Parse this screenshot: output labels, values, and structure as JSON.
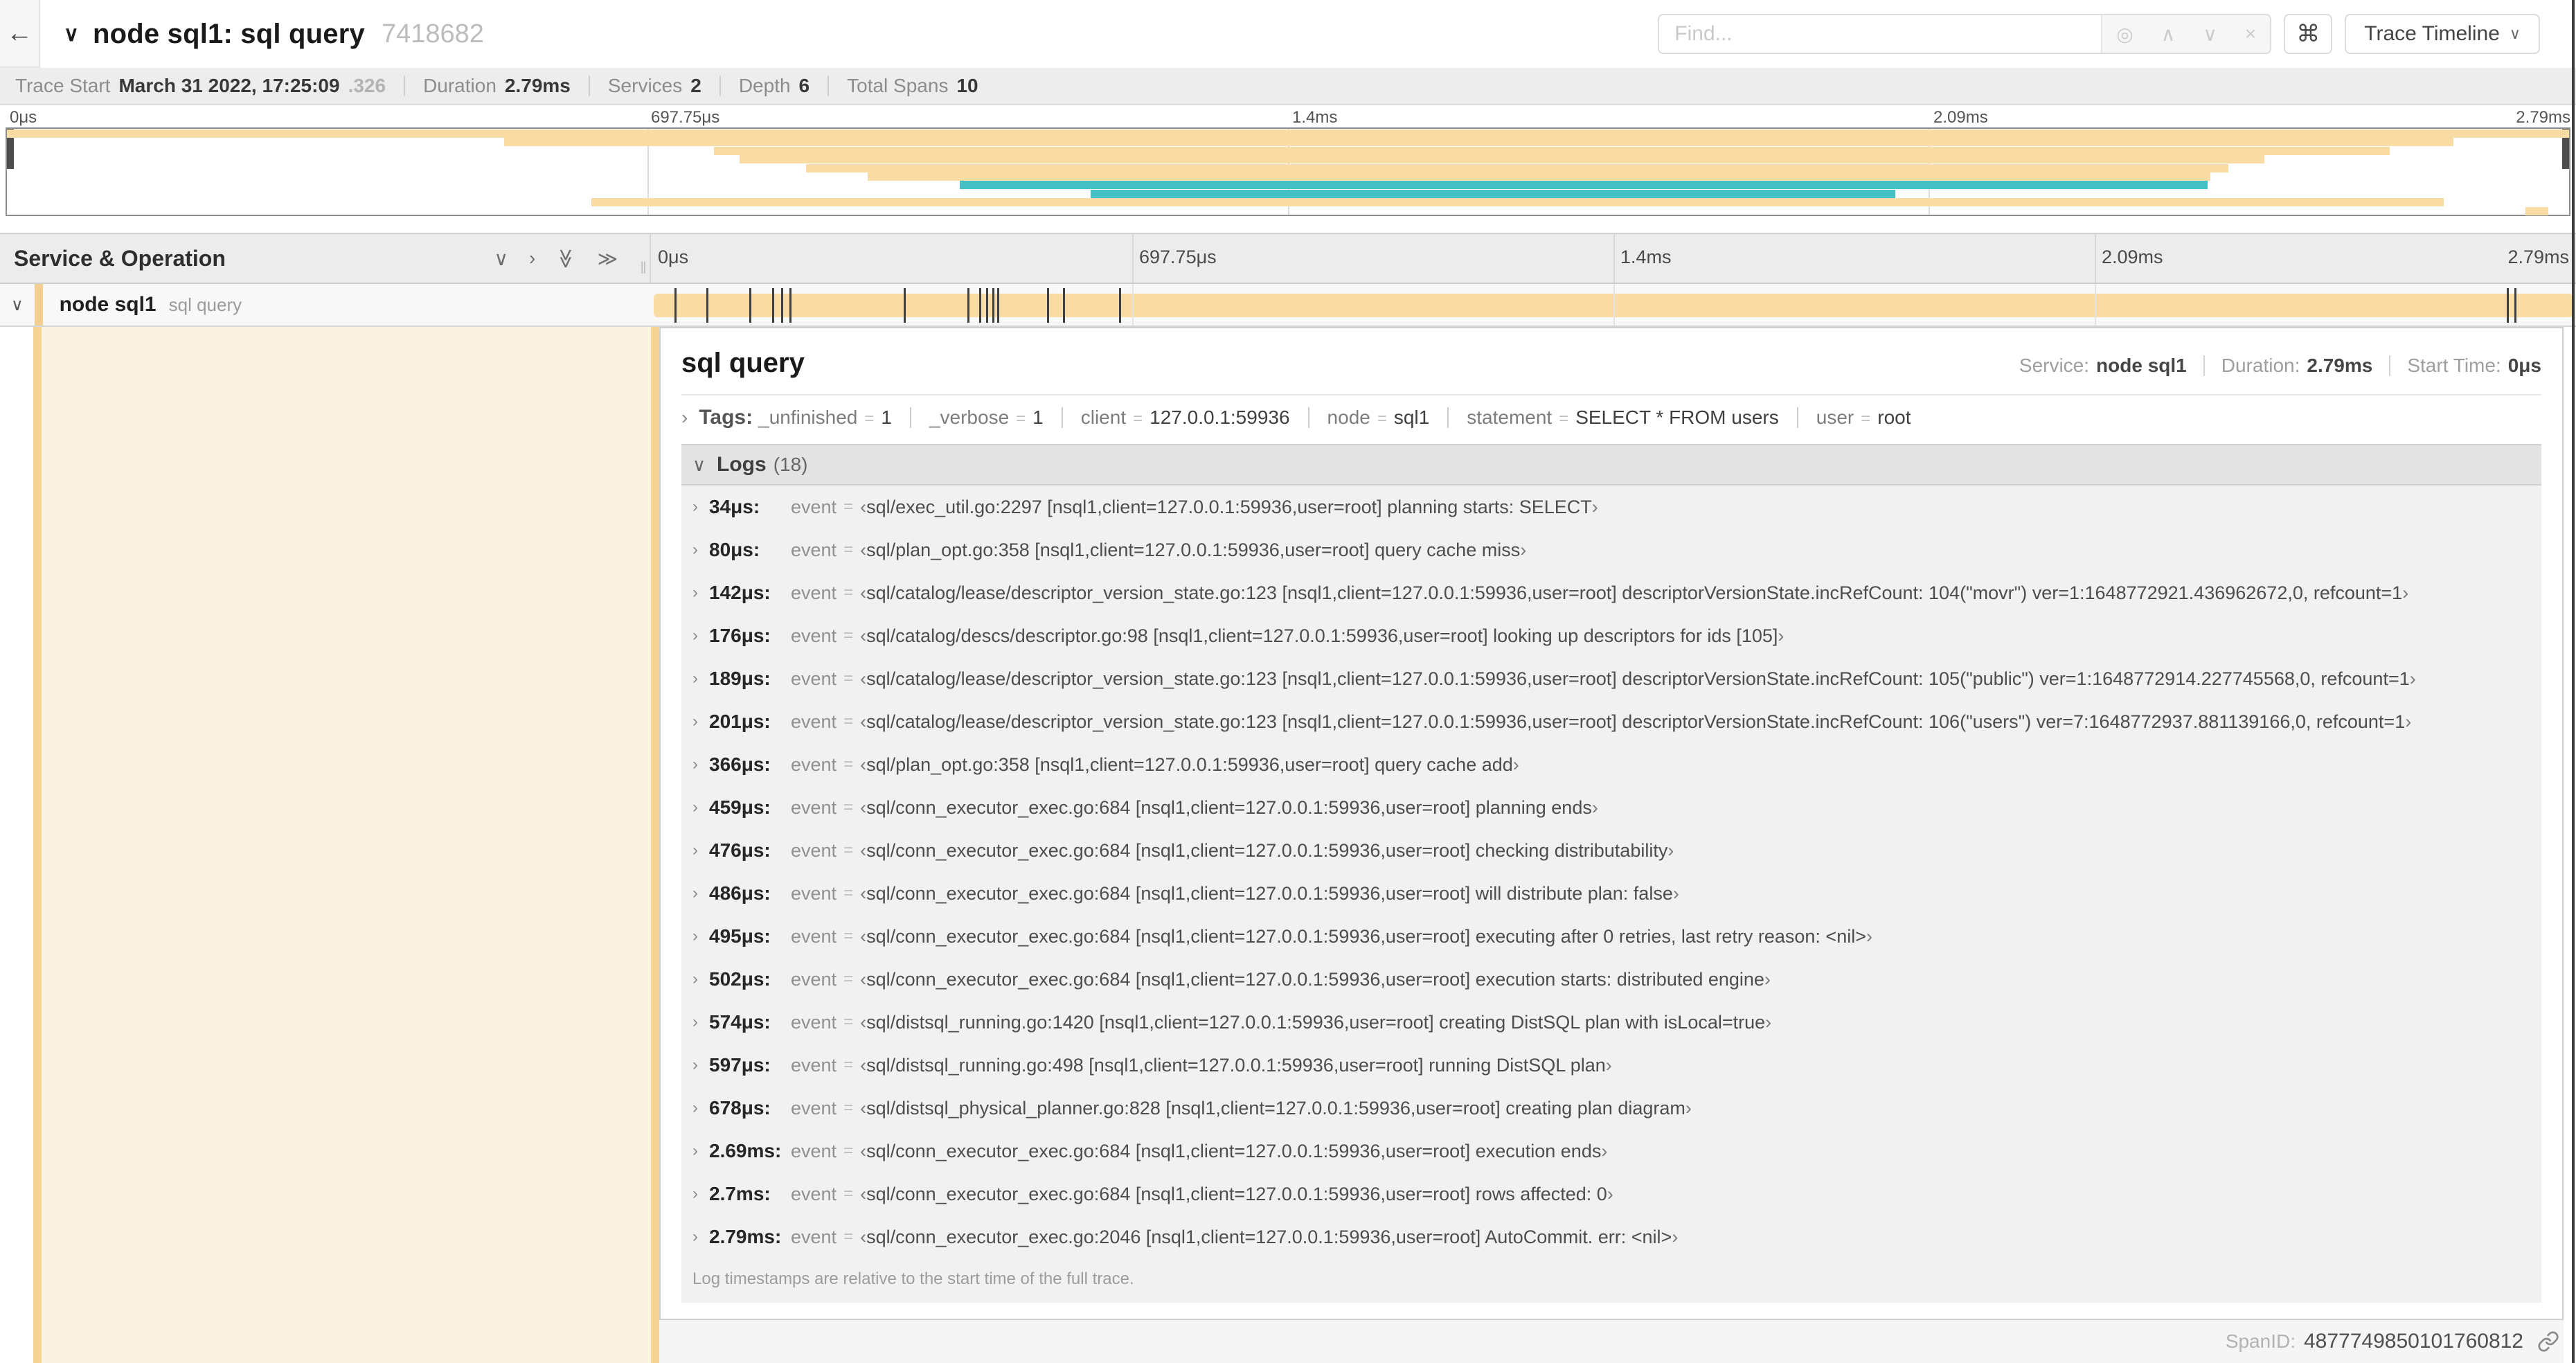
{
  "header": {
    "back": "←",
    "title": "node sql1: sql query",
    "trace_id": "7418682",
    "find_placeholder": "Find...",
    "shortcut": "⌘",
    "view_button": "Trace Timeline"
  },
  "summary": [
    {
      "label": "Trace Start",
      "value": "March 31 2022, 17:25:09",
      "suffix": ".326"
    },
    {
      "label": "Duration",
      "value": "2.79ms"
    },
    {
      "label": "Services",
      "value": "2"
    },
    {
      "label": "Depth",
      "value": "6"
    },
    {
      "label": "Total Spans",
      "value": "10"
    }
  ],
  "colors": {
    "tan": "#f8dca4",
    "teal": "#45c0c5",
    "cream": "#faf3e3",
    "accent": "#f4d394"
  },
  "minimap": {
    "ticks": [
      "0μs",
      "697.75μs",
      "1.4ms",
      "2.09ms",
      "2.79ms"
    ],
    "spans": [
      {
        "left": 0,
        "width": 100,
        "color": "tan"
      },
      {
        "left": 19.4,
        "width": 76.1,
        "color": "tan"
      },
      {
        "left": 27.6,
        "width": 65.4,
        "color": "tan"
      },
      {
        "left": 28.6,
        "width": 59.5,
        "color": "tan"
      },
      {
        "left": 31.2,
        "width": 55.5,
        "color": "tan"
      },
      {
        "left": 33.6,
        "width": 52.4,
        "color": "tan"
      },
      {
        "left": 37.2,
        "width": 48.7,
        "color": "teal"
      },
      {
        "left": 42.3,
        "width": 31.4,
        "color": "teal"
      },
      {
        "left": 22.8,
        "width": 72.3,
        "color": "tan"
      },
      {
        "left": 98.3,
        "width": 0.9,
        "color": "tan"
      }
    ]
  },
  "timeline": {
    "header": "Service & Operation",
    "ticks": [
      "0μs",
      "697.75μs",
      "1.4ms",
      "2.09ms",
      "2.79ms"
    ],
    "gridlines": [
      25,
      50,
      75
    ],
    "row": {
      "service": "node sql1",
      "operation": "sql query"
    },
    "log_marker_positions": [
      1.22,
      2.87,
      5.09,
      6.31,
      6.78,
      7.2,
      13.12,
      16.45,
      17.06,
      17.42,
      17.74,
      18.0,
      20.57,
      21.4,
      24.3,
      96.4,
      96.8,
      99.8
    ]
  },
  "detail": {
    "title": "sql query",
    "meta": [
      {
        "label": "Service:",
        "value": "node sql1"
      },
      {
        "label": "Duration:",
        "value": "2.79ms"
      },
      {
        "label": "Start Time:",
        "value": "0μs"
      }
    ],
    "tags_label": "Tags:",
    "tags": [
      {
        "key": "_unfinished",
        "value": "1"
      },
      {
        "key": "_verbose",
        "value": "1"
      },
      {
        "key": "client",
        "value": "127.0.0.1:59936"
      },
      {
        "key": "node",
        "value": "sql1"
      },
      {
        "key": "statement",
        "value": "SELECT * FROM users"
      },
      {
        "key": "user",
        "value": "root"
      }
    ],
    "logs_label": "Logs",
    "logs_count": "(18)",
    "log_field": "event",
    "logs": [
      {
        "time": "34μs:",
        "value": "sql/exec_util.go:2297 [nsql1,client=127.0.0.1:59936,user=root] planning starts: SELECT"
      },
      {
        "time": "80μs:",
        "value": "sql/plan_opt.go:358 [nsql1,client=127.0.0.1:59936,user=root] query cache miss"
      },
      {
        "time": "142μs:",
        "value": "sql/catalog/lease/descriptor_version_state.go:123 [nsql1,client=127.0.0.1:59936,user=root] descriptorVersionState.incRefCount: 104(\"movr\") ver=1:1648772921.436962672,0, refcount=1"
      },
      {
        "time": "176μs:",
        "value": "sql/catalog/descs/descriptor.go:98 [nsql1,client=127.0.0.1:59936,user=root] looking up descriptors for ids [105]"
      },
      {
        "time": "189μs:",
        "value": "sql/catalog/lease/descriptor_version_state.go:123 [nsql1,client=127.0.0.1:59936,user=root] descriptorVersionState.incRefCount: 105(\"public\") ver=1:1648772914.227745568,0, refcount=1"
      },
      {
        "time": "201μs:",
        "value": "sql/catalog/lease/descriptor_version_state.go:123 [nsql1,client=127.0.0.1:59936,user=root] descriptorVersionState.incRefCount: 106(\"users\") ver=7:1648772937.881139166,0, refcount=1"
      },
      {
        "time": "366μs:",
        "value": "sql/plan_opt.go:358 [nsql1,client=127.0.0.1:59936,user=root] query cache add"
      },
      {
        "time": "459μs:",
        "value": "sql/conn_executor_exec.go:684 [nsql1,client=127.0.0.1:59936,user=root] planning ends"
      },
      {
        "time": "476μs:",
        "value": "sql/conn_executor_exec.go:684 [nsql1,client=127.0.0.1:59936,user=root] checking distributability"
      },
      {
        "time": "486μs:",
        "value": "sql/conn_executor_exec.go:684 [nsql1,client=127.0.0.1:59936,user=root] will distribute plan: false"
      },
      {
        "time": "495μs:",
        "value": "sql/conn_executor_exec.go:684 [nsql1,client=127.0.0.1:59936,user=root] executing after 0 retries, last retry reason: <nil>"
      },
      {
        "time": "502μs:",
        "value": "sql/conn_executor_exec.go:684 [nsql1,client=127.0.0.1:59936,user=root] execution starts: distributed engine"
      },
      {
        "time": "574μs:",
        "value": "sql/distsql_running.go:1420 [nsql1,client=127.0.0.1:59936,user=root] creating DistSQL plan with isLocal=true"
      },
      {
        "time": "597μs:",
        "value": "sql/distsql_running.go:498 [nsql1,client=127.0.0.1:59936,user=root] running DistSQL plan"
      },
      {
        "time": "678μs:",
        "value": "sql/distsql_physical_planner.go:828 [nsql1,client=127.0.0.1:59936,user=root] creating plan diagram"
      },
      {
        "time": "2.69ms:",
        "value": "sql/conn_executor_exec.go:684 [nsql1,client=127.0.0.1:59936,user=root] execution ends"
      },
      {
        "time": "2.7ms:",
        "value": "sql/conn_executor_exec.go:684 [nsql1,client=127.0.0.1:59936,user=root] rows affected: 0"
      },
      {
        "time": "2.79ms:",
        "value": "sql/conn_executor_exec.go:2046 [nsql1,client=127.0.0.1:59936,user=root] AutoCommit. err: <nil>"
      }
    ],
    "footer_note": "Log timestamps are relative to the start time of the full trace.",
    "span_id_label": "SpanID:",
    "span_id": "4877749850101760812"
  }
}
